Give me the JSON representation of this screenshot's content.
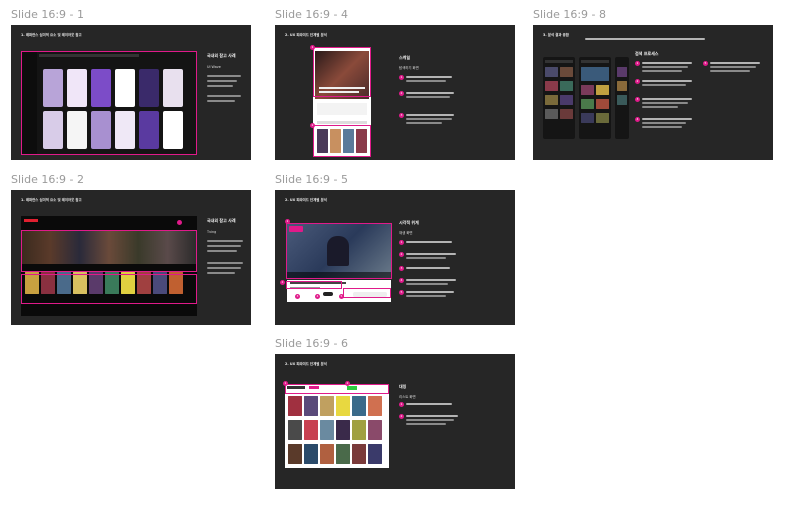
{
  "slides": [
    {
      "label": "Slide 16:9 - 1",
      "title": "1. 레퍼런스 심미적 요소 및 레이아웃 참고",
      "heading": "국내외 참고 사례",
      "subheading": "UI Wave"
    },
    {
      "label": "Slide 16:9 - 2",
      "title": "1. 레퍼런스 심미적 요소 및 레이아웃 참고",
      "heading": "국내외 참고 사례",
      "subheading": "Tving"
    },
    {
      "label": "Slide 16:9 - 4",
      "title": "2. UX 피라미드 단계별 분석",
      "heading": "스케일",
      "subheading": "탐색하기 화면"
    },
    {
      "label": "Slide 16:9 - 5",
      "title": "2. UX 피라미드 단계별 분석",
      "heading": "시각적 위계",
      "subheading": "재생 화면"
    },
    {
      "label": "Slide 16:9 - 6",
      "title": "2. UX 피라미드 단계별 분석",
      "heading": "대칭",
      "subheading": "리스트 화면"
    },
    {
      "label": "Slide 16:9 - 8",
      "title": "3. 분석 결과 종합",
      "heading": "검색 프로세스",
      "subheading": ""
    }
  ],
  "colors": {
    "slide_bg": "#262626",
    "accent": "#e01a8a",
    "canvas_bg": "#ffffff",
    "label": "#9a9a9a"
  }
}
